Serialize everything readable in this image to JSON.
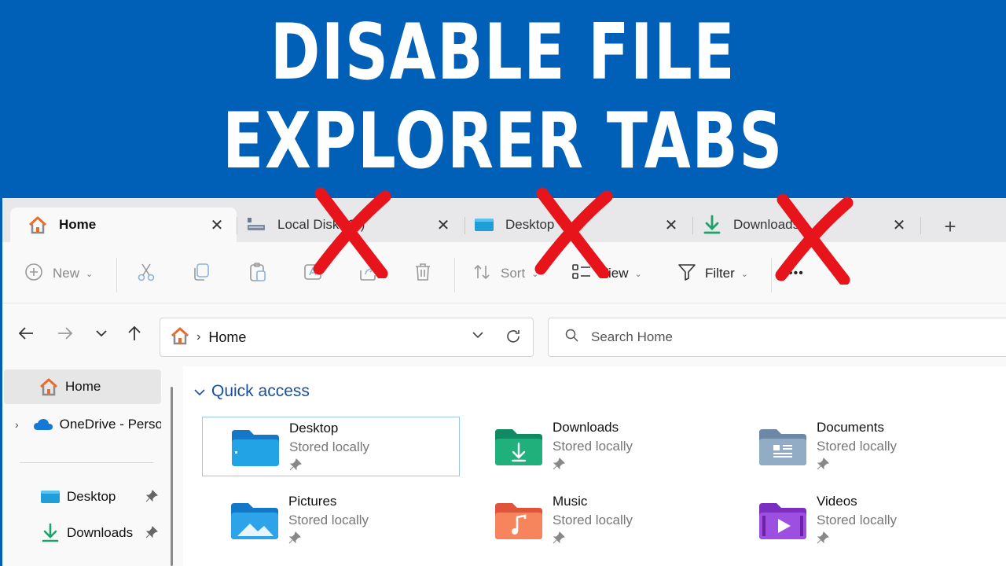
{
  "headline": {
    "line1": "DISABLE FILE",
    "line2": "EXPLORER TABS"
  },
  "tabs": [
    {
      "label": "Home",
      "icon": "home-icon",
      "close": "✕"
    },
    {
      "label": "Local Disk (C:)",
      "icon": "drive-icon",
      "close": "✕"
    },
    {
      "label": "Desktop",
      "icon": "desktop-icon",
      "close": "✕"
    },
    {
      "label": "Downloads",
      "icon": "download-icon",
      "close": "✕"
    }
  ],
  "new_tab": "+",
  "commands": {
    "new": "New",
    "sort": "Sort",
    "view": "View",
    "filter": "Filter",
    "more": "•••"
  },
  "address": {
    "path": "Home"
  },
  "search": {
    "placeholder": "Search Home"
  },
  "sidebar": {
    "home": "Home",
    "onedrive": "OneDrive - Personal",
    "desktop": "Desktop",
    "downloads": "Downloads"
  },
  "quick_access": {
    "title": "Quick access",
    "items": [
      {
        "name": "Desktop",
        "status": "Stored locally"
      },
      {
        "name": "Downloads",
        "status": "Stored locally"
      },
      {
        "name": "Documents",
        "status": "Stored locally"
      },
      {
        "name": "Pictures",
        "status": "Stored locally"
      },
      {
        "name": "Music",
        "status": "Stored locally"
      },
      {
        "name": "Videos",
        "status": "Stored locally"
      }
    ]
  },
  "colors": {
    "banner": "#0060b8",
    "accent_red": "#e8141b",
    "link_blue": "#1a4fa0"
  }
}
